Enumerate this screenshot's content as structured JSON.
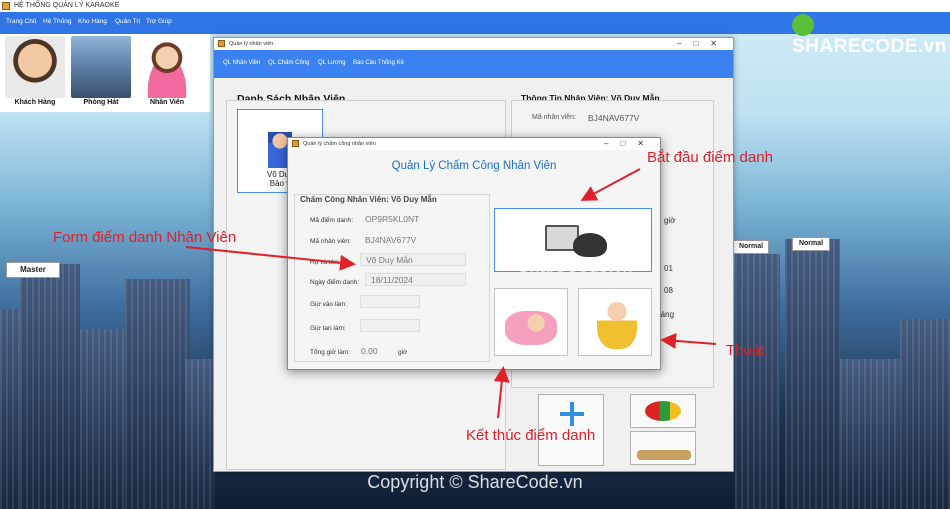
{
  "app": {
    "title": "HỆ THỐNG QUẢN LÝ KARAOKE",
    "menu": [
      "Trang Chủ",
      "Hệ Thống",
      "Kho Hàng",
      "Quản Trị",
      "Trợ Giúp"
    ],
    "toolbar": [
      {
        "label": "Khách Hàng"
      },
      {
        "label": "Phòng Hát"
      },
      {
        "label": "Nhân Viên"
      }
    ]
  },
  "employee_window": {
    "title": "Quản lý nhân viên",
    "menu": [
      "QL Nhân Viên",
      "QL Chấm Công",
      "QL Lương",
      "Báo Cáo Thống Kê"
    ],
    "list_title": "Danh Sách Nhân Viên",
    "card_name": "Võ Duy",
    "card_sub": "Bảo v",
    "info_title": "Thông Tin Nhân Viên: Võ Duy Mẫn",
    "info_label": "Mã nhân viên:",
    "info_value": "BJ4NAV677V",
    "partial_texts": [
      "giờ",
      "01",
      "08",
      "tháng"
    ]
  },
  "attendance_window": {
    "title": "Quản lý chấm công nhân viên",
    "heading": "Quản Lý Chấm Công Nhân Viên",
    "group_title": "Chấm Công Nhân Viên: Võ Duy Mẫn",
    "fields": [
      {
        "label": "Mã điểm danh:",
        "value": "OP9R5KL0NT"
      },
      {
        "label": "Mã nhân viên:",
        "value": "BJ4NAV677V"
      },
      {
        "label": "Họ và tên:",
        "value": "Võ Duy Mẫn"
      },
      {
        "label": "Ngày điểm danh:",
        "value": "18/11/2024"
      },
      {
        "label": "Giờ vào làm:",
        "value": ""
      },
      {
        "label": "Giờ tan làm:",
        "value": ""
      }
    ],
    "total_label": "Tổng giờ làm:",
    "total_value": "0.00",
    "total_unit": "giờ"
  },
  "annotations": {
    "start": "Bắt đầu điểm danh",
    "form": "Form điểm danh Nhân Viên",
    "exit": "Thoát",
    "end": "Kết thúc điểm danh"
  },
  "branding": {
    "logo": "SHARECODE.vn",
    "watermark_mid": "ShareCode.vn",
    "copyright": "Copyright © ShareCode.vn",
    "badges": [
      "Master",
      "Normal",
      "Normal"
    ]
  },
  "colors": {
    "accent": "#2f75e6",
    "annotation": "#e0202a",
    "heading": "#1a70c8"
  }
}
